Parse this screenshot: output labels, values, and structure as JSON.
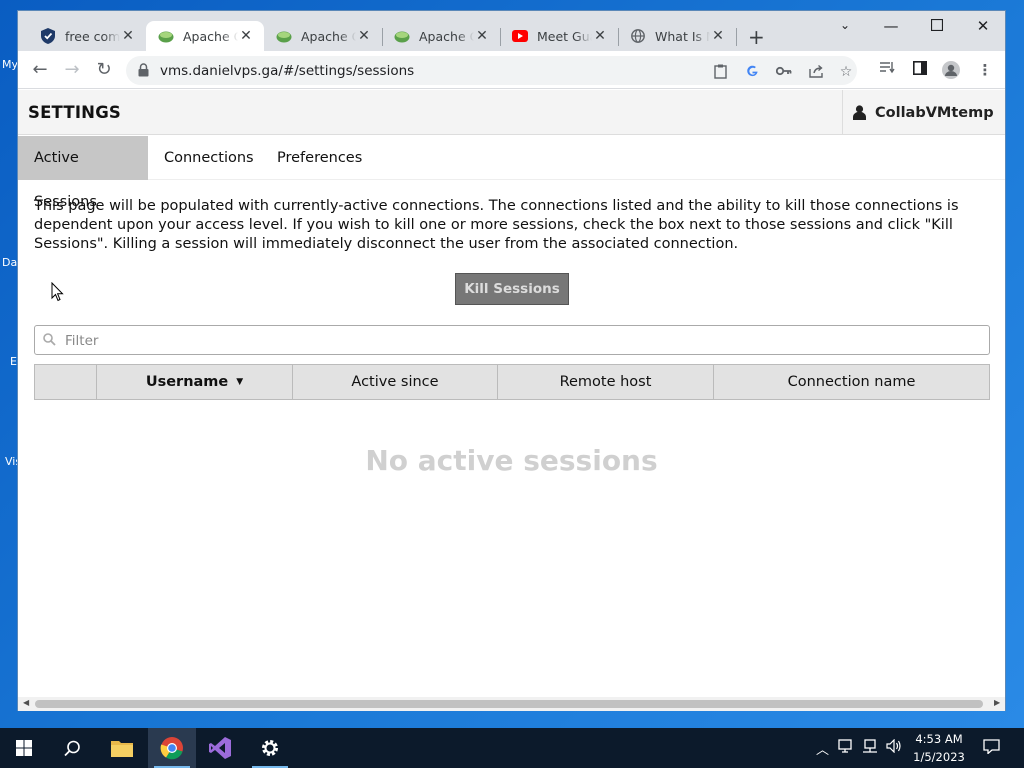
{
  "desktop": {
    "labels": [
      "My",
      "Da",
      "E",
      "Vis"
    ]
  },
  "browser": {
    "tabs": [
      {
        "title": "free comp",
        "icon": "shield-icon"
      },
      {
        "title": "Apache Gu",
        "icon": "guacamole-icon"
      },
      {
        "title": "Apache Gu",
        "icon": "guacamole-icon"
      },
      {
        "title": "Apache Gu",
        "icon": "guacamole-icon"
      },
      {
        "title": "Meet Gua",
        "icon": "youtube-icon"
      },
      {
        "title": "What Is M",
        "icon": "globe-icon"
      }
    ],
    "url": "vms.danielvps.ga/#/settings/sessions"
  },
  "page": {
    "title": "SETTINGS",
    "user": "CollabVMtemp",
    "tabs": [
      "Active Sessions",
      "Connections",
      "Preferences"
    ],
    "description": "This page will be populated with currently-active connections. The connections listed and the ability to kill those connections is dependent upon your access level. If you wish to kill one or more sessions, check the box next to those sessions and click \"Kill Sessions\". Killing a session will immediately disconnect the user from the associated connection.",
    "kill_button": "Kill Sessions",
    "filter_placeholder": "Filter",
    "columns": [
      "",
      "Username",
      "Active since",
      "Remote host",
      "Connection name"
    ],
    "empty_message": "No active sessions"
  },
  "taskbar": {
    "time": "4:53 AM",
    "date": "1/5/2023"
  },
  "colors": {
    "accent": "#76b9ed",
    "youtube": "#ff0000",
    "guacamole": "#5aa04a"
  }
}
